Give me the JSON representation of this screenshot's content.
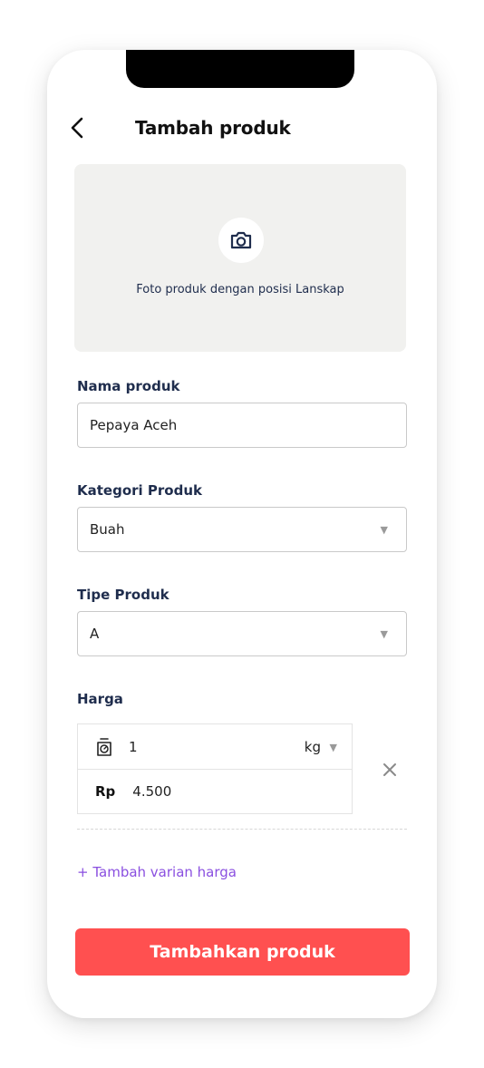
{
  "header": {
    "title": "Tambah produk"
  },
  "photo": {
    "hint": "Foto produk dengan posisi Lanskap"
  },
  "fields": {
    "nama": {
      "label": "Nama produk",
      "value": "Pepaya Aceh"
    },
    "kategori": {
      "label": "Kategori Produk",
      "value": "Buah"
    },
    "tipe": {
      "label": "Tipe Produk",
      "value": "A"
    }
  },
  "harga": {
    "label": "Harga",
    "quantity": "1",
    "unit": "kg",
    "currency": "Rp",
    "price": "4.500"
  },
  "add_variant": "+ Tambah varian harga",
  "submit": "Tambahkan produk",
  "colors": {
    "primary": "#ff5050",
    "link": "#8a4fe0",
    "text": "#1f2d4d"
  },
  "icons": [
    "back-arrow-icon",
    "camera-icon",
    "dropdown-caret-icon",
    "scale-icon",
    "close-icon"
  ]
}
